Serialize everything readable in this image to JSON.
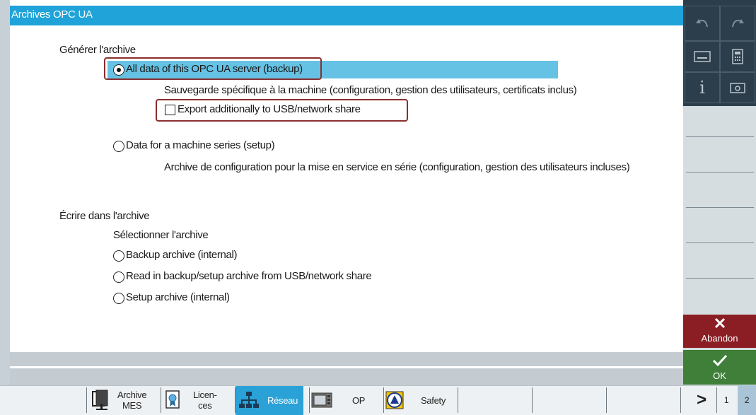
{
  "window": {
    "title": "Archives OPC UA"
  },
  "generate_section": {
    "heading": "Générer l'archive",
    "option_all_data": {
      "label": "All data of this OPC UA server (backup)",
      "checked": true
    },
    "all_data_desc": "Sauvegarde spécifique à la machine (configuration, gestion des utilisateurs, certificats inclus)",
    "export_checkbox": {
      "label": "Export additionally to USB/network share",
      "checked": false
    },
    "option_machine_series": {
      "label": "Data for a machine series (setup)",
      "checked": false
    },
    "machine_series_desc": "Archive de configuration pour la mise en service en série (configuration, gestion des utilisateurs incluses)"
  },
  "write_section": {
    "heading": "Écrire dans l'archive",
    "subheading": "Sélectionner l'archive",
    "options": [
      {
        "label": "Backup archive (internal)"
      },
      {
        "label": "Read in backup/setup archive from USB/network share"
      },
      {
        "label": "Setup archive (internal)"
      }
    ]
  },
  "side_panel": {
    "abandon_label": "Abandon",
    "ok_label": "OK",
    "icons": [
      "undo-icon",
      "redo-icon",
      "keyboard-icon",
      "calculator-icon",
      "info-icon",
      "screenshot-icon"
    ]
  },
  "bottom_bar": {
    "tabs": [
      {
        "label": "Archive\nMES",
        "icon": "archive-mes-icon"
      },
      {
        "label": "Licen-\nces",
        "icon": "license-icon"
      },
      {
        "label": "Réseau",
        "icon": "network-icon",
        "active": true
      },
      {
        "label": "OP",
        "icon": "op-panel-icon"
      },
      {
        "label": "Safety",
        "icon": "safety-icon"
      }
    ],
    "next_label": ">",
    "pages": [
      "1",
      "2"
    ],
    "active_page": "2"
  },
  "colors": {
    "titlebar": "#1fa3d8",
    "selection": "#66c2e4",
    "highlight_border": "#8b2e2e",
    "abandon": "#8b1e24",
    "ok": "#3f7f3a",
    "active_tab": "#2aa2d8"
  }
}
